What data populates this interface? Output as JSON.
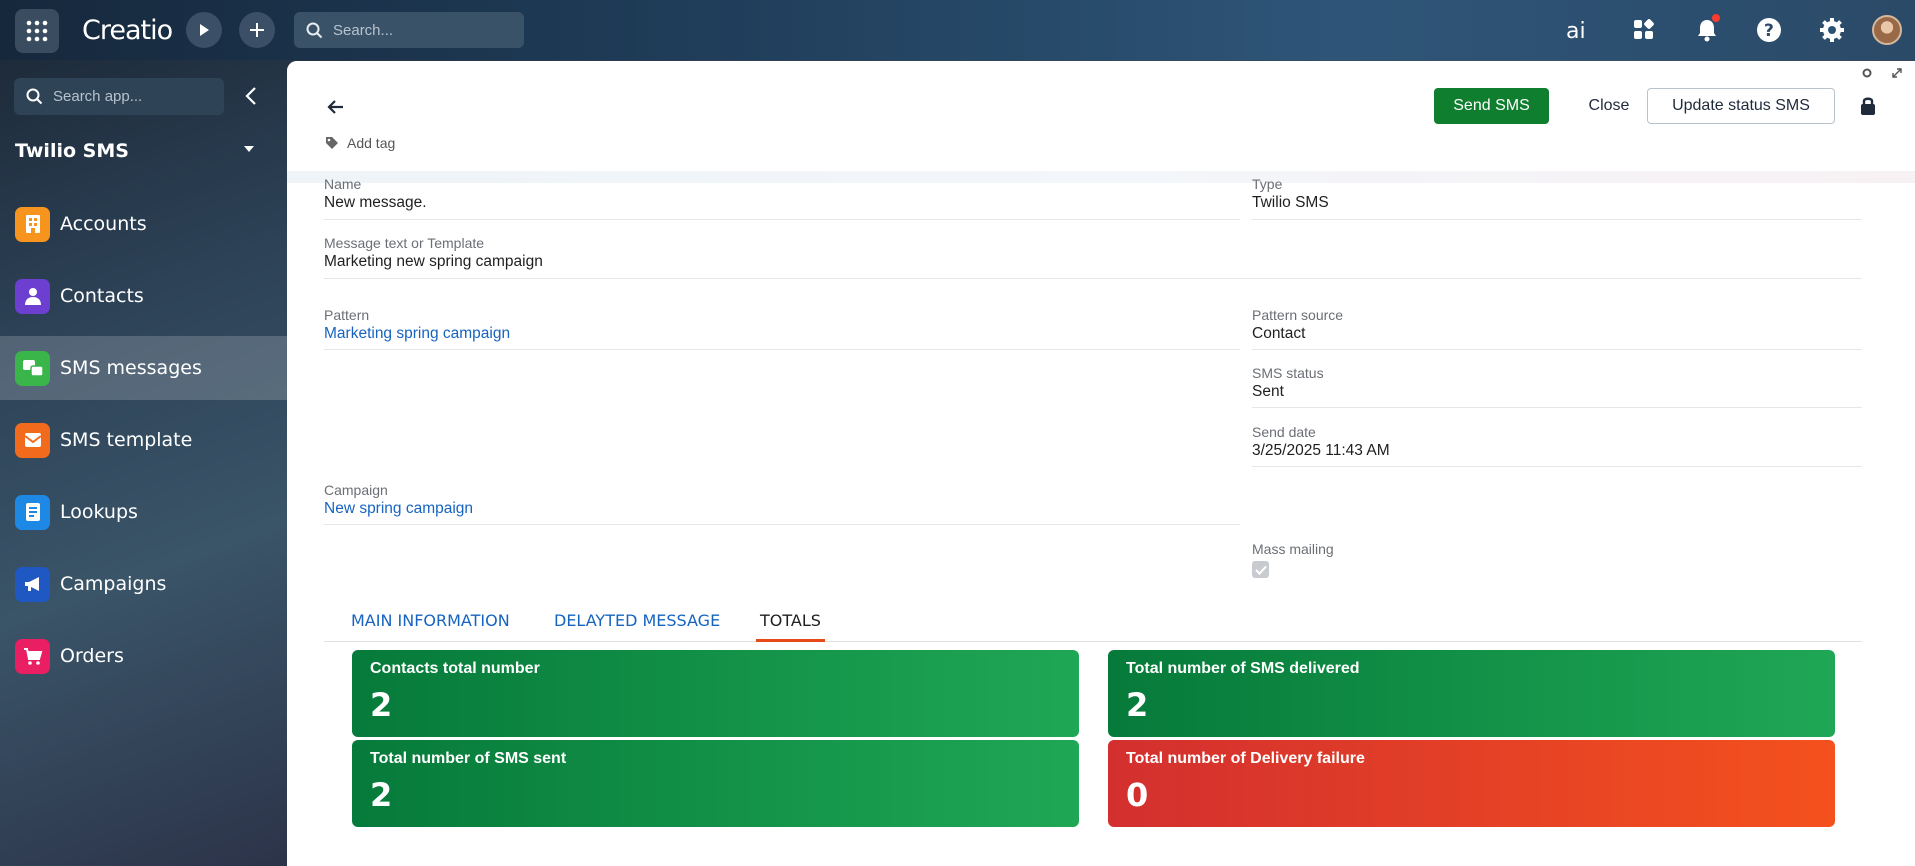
{
  "topbar": {
    "logo": "Creatio",
    "search_placeholder": "Search..."
  },
  "sidebar": {
    "search_placeholder": "Search app...",
    "workspace": "Twilio SMS",
    "items": [
      {
        "label": "Accounts",
        "icon": "building-icon",
        "color": "#f7941d"
      },
      {
        "label": "Contacts",
        "icon": "person-icon",
        "color": "#6c3fd1"
      },
      {
        "label": "SMS messages",
        "icon": "sms-icon",
        "color": "#39b54a"
      },
      {
        "label": "SMS template",
        "icon": "template-icon",
        "color": "#f26b1d"
      },
      {
        "label": "Lookups",
        "icon": "list-icon",
        "color": "#1e88e5"
      },
      {
        "label": "Campaigns",
        "icon": "megaphone-icon",
        "color": "#1f57c3"
      },
      {
        "label": "Orders",
        "icon": "cart-icon",
        "color": "#e91e63"
      }
    ]
  },
  "header": {
    "add_tag": "Add tag",
    "send_sms": "Send SMS",
    "close": "Close",
    "update_status": "Update status SMS"
  },
  "fields": {
    "name": {
      "label": "Name",
      "value": "New message."
    },
    "type": {
      "label": "Type",
      "value": "Twilio SMS"
    },
    "message": {
      "label": "Message text or Template",
      "value": "Marketing new spring campaign"
    },
    "pattern": {
      "label": "Pattern",
      "value": "Marketing spring campaign"
    },
    "pattern_source": {
      "label": "Pattern source",
      "value": "Contact"
    },
    "sms_status": {
      "label": "SMS status",
      "value": "Sent"
    },
    "send_date": {
      "label": "Send date",
      "value": "3/25/2025 11:43 AM"
    },
    "campaign": {
      "label": "Campaign",
      "value": "New spring campaign"
    },
    "mass_mailing": {
      "label": "Mass mailing",
      "checked": true
    }
  },
  "tabs": [
    "MAIN INFORMATION",
    "DELAYTED MESSAGE",
    "TOTALS"
  ],
  "active_tab": "TOTALS",
  "totals": [
    {
      "title": "Contacts total number",
      "value": "2",
      "color": "green"
    },
    {
      "title": "Total number of SMS delivered",
      "value": "2",
      "color": "green"
    },
    {
      "title": "Total number of SMS sent",
      "value": "2",
      "color": "green"
    },
    {
      "title": "Total number of Delivery failure",
      "value": "0",
      "color": "red"
    }
  ]
}
